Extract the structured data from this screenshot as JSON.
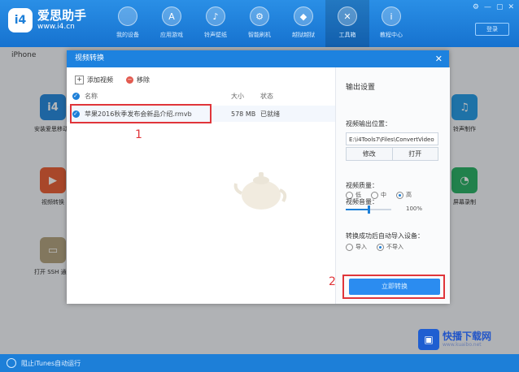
{
  "app": {
    "title": "爱思助手",
    "url": "www.i4.cn",
    "logo_text": "i4"
  },
  "nav": [
    {
      "label": "我的设备",
      "icon": "apple-icon",
      "glyph": ""
    },
    {
      "label": "应用游戏",
      "icon": "appstore-icon",
      "glyph": "A"
    },
    {
      "label": "铃声壁纸",
      "icon": "bell-icon",
      "glyph": "♪"
    },
    {
      "label": "智能刷机",
      "icon": "flash-icon",
      "glyph": "⚙"
    },
    {
      "label": "越狱越狱",
      "icon": "box-icon",
      "glyph": "◆"
    },
    {
      "label": "工具箱",
      "icon": "tools-icon",
      "glyph": "✕"
    },
    {
      "label": "教程中心",
      "icon": "info-icon",
      "glyph": "i"
    }
  ],
  "window_controls": [
    "⚙",
    "—",
    "▢",
    "✕"
  ],
  "login_label": "登录",
  "device_label": "iPhone",
  "tools": [
    {
      "label": "安装爱思移动端",
      "glyph": "i4",
      "color": "#2a8ce0"
    },
    {
      "label": "视频转换",
      "glyph": "▶",
      "color": "#e9633b"
    },
    {
      "label": "打开 SSH 通道",
      "glyph": "▭",
      "color": "#b5a583"
    },
    {
      "label": "铃声制作",
      "glyph": "♫",
      "color": "#2a9ee8"
    },
    {
      "label": "屏幕录制",
      "glyph": "◔",
      "color": "#2fb36a"
    }
  ],
  "dialog": {
    "title": "视频转换",
    "close": "✕",
    "toolbar": {
      "add_label": "添加视频",
      "remove_label": "移除"
    },
    "columns": {
      "name": "名称",
      "size": "大小",
      "status": "状态"
    },
    "rows": [
      {
        "name": "苹果2016秋季发布会新品介绍.rmvb",
        "size": "578 MB",
        "status": "已就绪"
      }
    ],
    "settings": {
      "title": "输出设置",
      "output_label": "视频输出位置：",
      "output_path": "E:\\i4Tools7\\Files\\ConvertVideo",
      "modify_label": "修改",
      "open_label": "打开",
      "quality_label": "视频质量：",
      "quality_options": [
        "低",
        "中",
        "高"
      ],
      "quality_selected": "高",
      "volume_label": "视频音量：",
      "volume_value": "100%",
      "volume_fraction": 0.5,
      "import_label": "转换成功后自动导入设备：",
      "import_options": [
        "导入",
        "不导入"
      ],
      "import_selected": "不导入",
      "convert_label": "立即转换"
    },
    "markers": {
      "row": "1",
      "convert": "2"
    }
  },
  "statusbar": {
    "text": "阻止iTunes自动运行"
  },
  "watermark": {
    "text": "快播下载网",
    "url": "www.kuaibo.net"
  }
}
